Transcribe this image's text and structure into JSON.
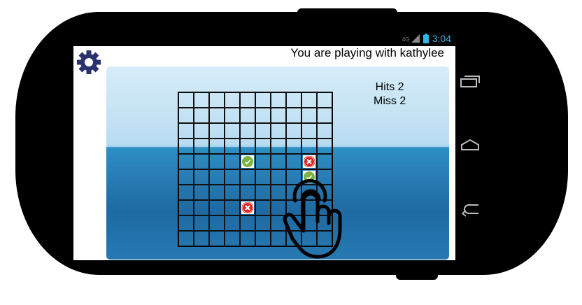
{
  "status_bar": {
    "network": "4G",
    "time": "3:04"
  },
  "header": {
    "title": "You are playing with kathylee",
    "settings_icon": "gear-icon"
  },
  "score": {
    "hits_label": "Hits 2",
    "miss_label": "Miss 2"
  },
  "board": {
    "rows": 10,
    "cols": 10,
    "marks": [
      {
        "row": 4,
        "col": 4,
        "type": "hit"
      },
      {
        "row": 4,
        "col": 8,
        "type": "miss"
      },
      {
        "row": 5,
        "col": 8,
        "type": "hit"
      },
      {
        "row": 7,
        "col": 4,
        "type": "miss"
      }
    ]
  },
  "colors": {
    "status": "#33b5e5",
    "hit": "#7cb342",
    "miss": "#e02020",
    "gear": "#2a3170"
  },
  "nav_buttons": [
    "recent-apps",
    "home",
    "back"
  ]
}
